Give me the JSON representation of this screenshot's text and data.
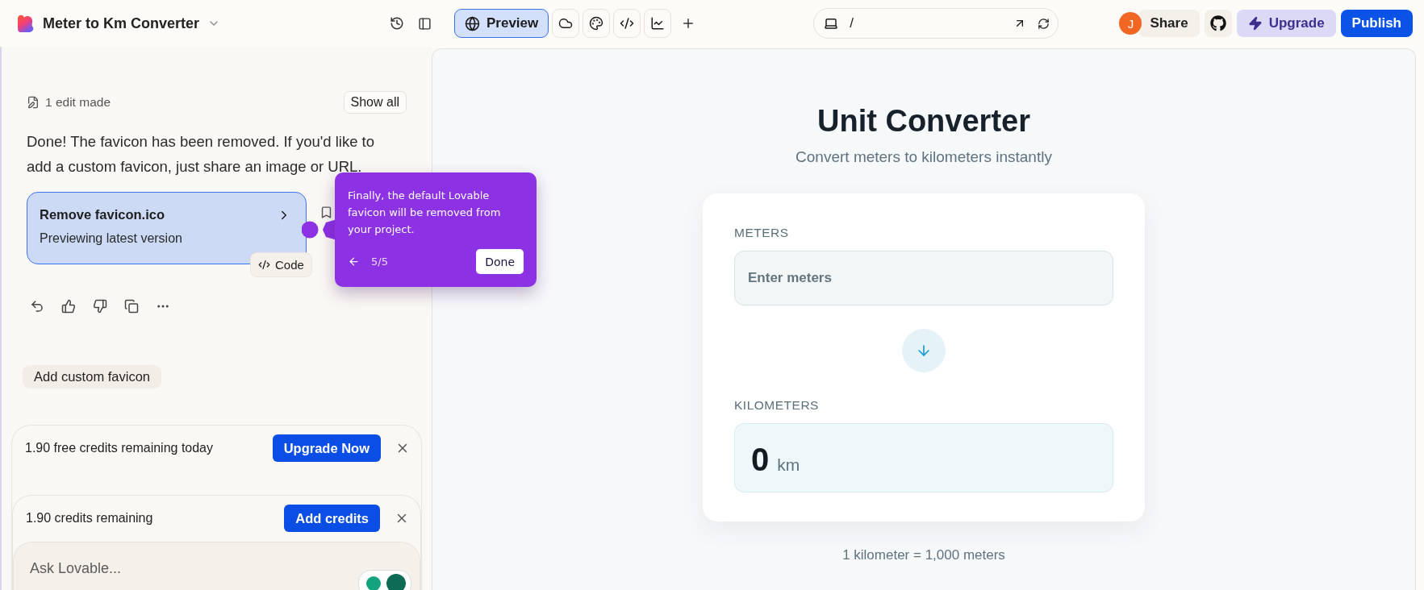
{
  "project": {
    "title": "Meter to Km Converter"
  },
  "toolbar": {
    "tabs": [
      {
        "kind": "preview",
        "label": "Preview",
        "selected": true
      },
      {
        "kind": "cloud",
        "selected": false
      },
      {
        "kind": "palette",
        "selected": false
      },
      {
        "kind": "code",
        "selected": false
      },
      {
        "kind": "chart",
        "selected": false
      }
    ]
  },
  "address_bar": {
    "path": "/"
  },
  "account": {
    "avatar": "J",
    "share": "Share",
    "upgrade": "Upgrade",
    "publish": "Publish"
  },
  "chat": {
    "edits": {
      "label": "1 edit made",
      "button": "Show all"
    },
    "message": "Done! The favicon has been removed. If you'd like to add a custom favicon, just share an image or URL.",
    "version_card": {
      "title": "Remove favicon.ico",
      "subtitle": "Previewing latest version",
      "code_button": "Code",
      "selected": true
    },
    "suggestion": "Add custom favicon",
    "notices": [
      {
        "text": "1.90 free credits remaining today",
        "button": "Upgrade Now"
      },
      {
        "text": "1.90 credits remaining",
        "button": "Add credits"
      }
    ],
    "input": {
      "placeholder": "Ask Lovable..."
    }
  },
  "tour_tooltip": {
    "text": "Finally, the default Lovable favicon will be removed from your project.",
    "step": "5/5",
    "button": "Done"
  },
  "preview": {
    "title": "Unit Converter",
    "subtitle": "Convert meters to kilometers instantly",
    "meters": {
      "label": "METERS",
      "placeholder": "Enter meters"
    },
    "kilometers": {
      "label": "KILOMETERS",
      "value": "0",
      "unit": "km"
    },
    "footnote": "1 kilometer = 1,000 meters"
  }
}
